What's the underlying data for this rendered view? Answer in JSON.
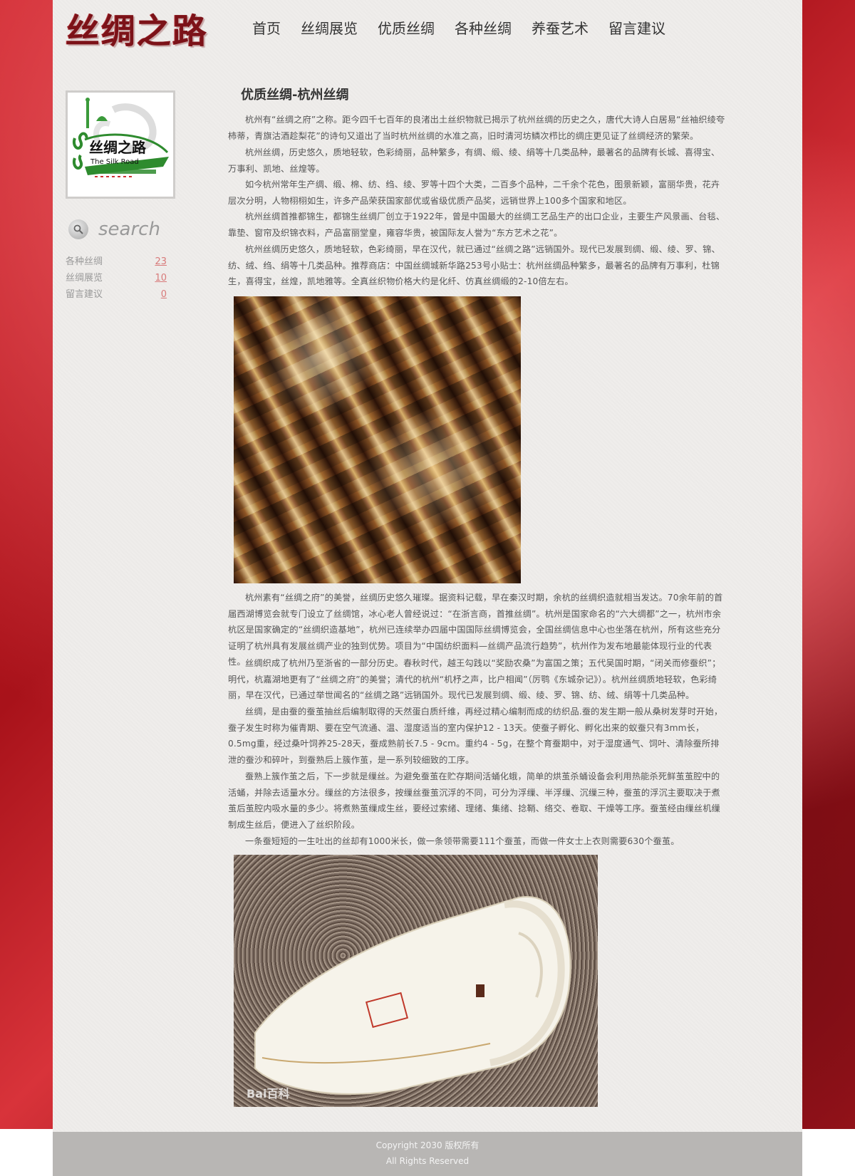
{
  "header": {
    "logo_text": "丝绸之路",
    "nav": [
      "首页",
      "丝绸展览",
      "优质丝绸",
      "各种丝绸",
      "养蚕艺术",
      "留言建议"
    ]
  },
  "sidebar": {
    "logo_cn": "丝绸之路",
    "logo_en": "The Silk Road",
    "search_placeholder": "search",
    "categories": [
      {
        "label": "各种丝绸",
        "count": "23"
      },
      {
        "label": "丝绸展览",
        "count": "10"
      },
      {
        "label": "留言建议",
        "count": "0"
      }
    ]
  },
  "article": {
    "title": "优质丝绸-杭州丝绸",
    "paragraphs_top": [
      "杭州有“丝绸之府”之称。距今四千七百年的良渚出土丝织物就已揭示了杭州丝绸的历史之久，唐代大诗人白居易“丝袖织绫夸柿蒂，青旗沽酒趁梨花”的诗句又道出了当时杭州丝绸的水准之高，旧时清河坊鳞次栉比的绸庄更见证了丝绸经济的繁荣。",
      "杭州丝绸，历史悠久，质地轻软，色彩绮丽，品种繁多，有绸、缎、绫、绢等十几类品种，最著名的品牌有长城、喜得宝、万事利、凯地、丝煌等。",
      "如今杭州常年生产绸、缎、棉、纺、绉、绫、罗等十四个大类，二百多个品种，二千余个花色，图景新颖，富丽华贵，花卉层次分明，人物栩栩如生，许多产品荣获国家部优或省级优质产品奖，远销世界上100多个国家和地区。",
      "杭州丝绸首推都锦生，都锦生丝绸厂创立于1922年，曾是中国最大的丝绸工艺品生产的出口企业，主要生产风景画、台毯、靠垫、窗帘及织锦衣料，产品富丽堂皇，雍容华贵，被国际友人誉为“东方艺术之花”。",
      "杭州丝绸历史悠久，质地轻软，色彩绮丽，早在汉代，就已通过“丝绸之路”远销国外。现代已发展到绸、缎、绫、罗、锦、纺、绒、绉、绢等十几类品种。推荐商店：中国丝绸城新华路253号小贴士：杭州丝绸品种繁多，最著名的品牌有万事利，杜锦生，喜得宝，丝煌，凯地雅等。全真丝织物价格大约是化纤、仿真丝绸缎的2-10倍左右。"
    ],
    "paragraphs_bottom": [
      "杭州素有“丝绸之府”的美誉，丝绸历史悠久璀璨。据资料记载，早在秦汉时期，余杭的丝绸织造就相当发达。70余年前的首届西湖博览会就专门设立了丝绸馆，冰心老人曾经说过：“在浙言商，首推丝绸”。杭州是国家命名的“六大绸都”之一，杭州市余杭区是国家确定的“丝绸织造基地”，杭州已连续举办四届中国国际丝绸博览会，全国丝绸信息中心也坐落在杭州，所有这些充分证明了杭州具有发展丝绸产业的独到优势。项目为“中国纺织面料—丝绸产品流行趋势”，杭州作为发布地最能体现行业的代表性。",
      "丝绸织成了杭州乃至浙省的一部分历史。春秋时代，越王勾践以“奖励农桑”为富国之策；五代吴国时期，“闭关而修蚕织”；明代，杭嘉湖地更有了“丝绸之府”的美誉；清代的杭州“机杼之声，比户相闻”（厉鹗《东城杂记》）。杭州丝绸质地轻软，色彩绮丽，早在汉代，已通过举世闻名的“丝绸之路”远销国外。现代已发展到绸、缎、绫、罗、锦、纺、绒、绢等十几类品种。",
      "丝绸，是由蚕的蚕茧抽丝后编制取得的天然蛋白质纤维，再经过精心编制而成的纺织品.蚕的发生期一般从桑树发芽时开始，蚕子发生时称为催青期、要在空气流通、温、湿度适当的室内保护12 - 13天。使蚕子孵化、孵化出来的蚁蚕只有3mm长，0.5mg重，经过桑叶饲养25-28天，蚕成熟前长7.5 - 9cm。重约4 - 5g，在整个育蚕期中，对于湿度通气、饲叶、清除蚕所排泄的蚕沙和碎叶，到蚕熟后上簇作茧，是一系列较细致的工序。",
      "蚕熟上簇作茧之后，下一步就是缫丝。为避免蚕茧在贮存期间活蛹化蛾，简单的烘茧杀蛹设备会利用热能杀死鲜茧茧腔中的活蛹，并除去适量水分。缫丝的方法很多，按缫丝蚕茧沉浮的不同，可分为浮缫、半浮缫、沉缫三种，蚕茧的浮沉主要取决于煮茧后茧腔内吸水量的多少。将煮熟茧缫成生丝，要经过索绪、理绪、集绪、捻鞘、络交、卷取、干燥等工序。蚕茧经由缫丝机缫制成生丝后，便进入了丝织阶段。",
      "一条蚕短短的一生吐出的丝却有1000米长，做一条领带需要111个蚕茧，而做一件女士上衣则需要630个蚕茧。"
    ],
    "quilt_watermark": "Bai百科"
  },
  "footer": {
    "copyright": "Copyright 2030 版权所有",
    "rights": "All Rights Reserved"
  }
}
